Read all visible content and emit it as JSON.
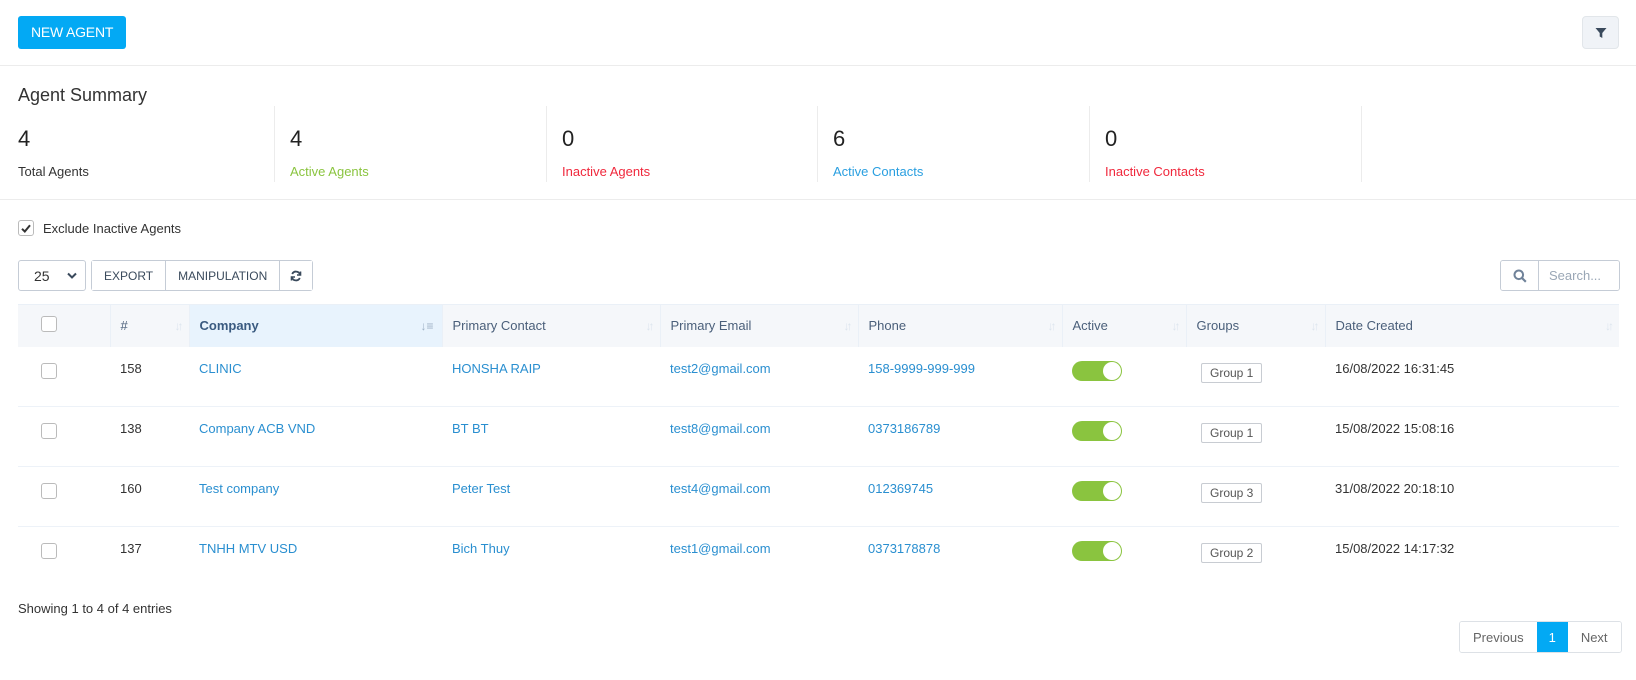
{
  "toolbar": {
    "new_agent_label": "NEW AGENT",
    "filter_icon": "filter-icon"
  },
  "summary": {
    "title": "Agent Summary",
    "stats": [
      {
        "value": "4",
        "label": "Total Agents",
        "color": "#333333"
      },
      {
        "value": "4",
        "label": "Active Agents",
        "color": "#8ac43f"
      },
      {
        "value": "0",
        "label": "Inactive Agents",
        "color": "#f0283c"
      },
      {
        "value": "6",
        "label": "Active Contacts",
        "color": "#2a9fe0"
      },
      {
        "value": "0",
        "label": "Inactive Contacts",
        "color": "#f0283c"
      }
    ]
  },
  "filters": {
    "exclude_inactive_label": "Exclude Inactive Agents",
    "exclude_inactive_checked": true
  },
  "table_controls": {
    "page_length": "25",
    "export_label": "EXPORT",
    "manipulation_label": "MANIPULATION",
    "refresh_icon": "refresh-icon",
    "search_placeholder": "Search..."
  },
  "table": {
    "columns": [
      "#",
      "Company",
      "Primary Contact",
      "Primary Email",
      "Phone",
      "Active",
      "Groups",
      "Date Created"
    ],
    "sorted_column": "Company",
    "rows": [
      {
        "id": "158",
        "company": "CLINIC",
        "contact": "HONSHA RAIP",
        "email": "test2@gmail.com",
        "phone": "158-9999-999-999",
        "active": true,
        "group": "Group 1",
        "date": "16/08/2022 16:31:45"
      },
      {
        "id": "138",
        "company": "Company ACB VND",
        "contact": "BT BT",
        "email": "test8@gmail.com",
        "phone": "0373186789",
        "active": true,
        "group": "Group 1",
        "date": "15/08/2022 15:08:16"
      },
      {
        "id": "160",
        "company": "Test company",
        "contact": "Peter Test",
        "email": "test4@gmail.com",
        "phone": "012369745",
        "active": true,
        "group": "Group 3",
        "date": "31/08/2022 20:18:10"
      },
      {
        "id": "137",
        "company": "TNHH MTV USD",
        "contact": "Bich Thuy",
        "email": "test1@gmail.com",
        "phone": "0373178878",
        "active": true,
        "group": "Group 2",
        "date": "15/08/2022 14:17:32"
      }
    ]
  },
  "footer": {
    "info": "Showing 1 to 4 of 4 entries",
    "previous_label": "Previous",
    "current_page": "1",
    "next_label": "Next"
  },
  "colors": {
    "accent": "#03a9f4",
    "toggle_on": "#8ac43f",
    "link": "#2a8fd0"
  }
}
